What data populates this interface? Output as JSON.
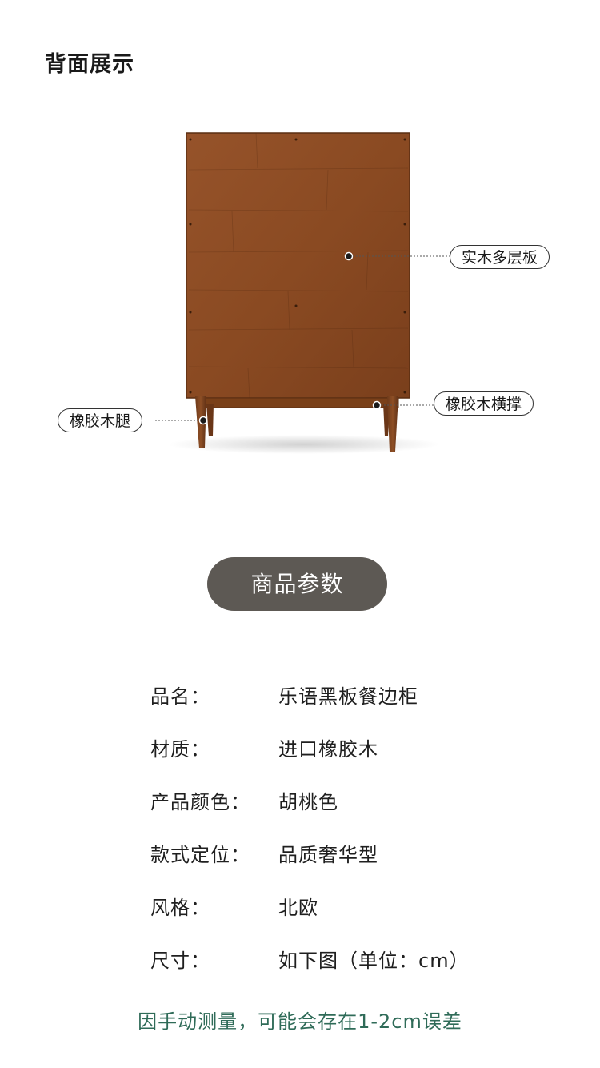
{
  "header": {
    "title": "背面展示"
  },
  "figure": {
    "callouts": {
      "plywood": "实木多层板",
      "brace": "橡胶木横撑",
      "leg": "橡胶木腿"
    }
  },
  "params": {
    "heading": "商品参数",
    "rows": [
      {
        "label": "品名：",
        "value": "乐语黑板餐边柜"
      },
      {
        "label": "材质：",
        "value": "进口橡胶木"
      },
      {
        "label": "产品颜色：",
        "value": "胡桃色"
      },
      {
        "label": "款式定位：",
        "value": "品质奢华型"
      },
      {
        "label": "风格：",
        "value": "北欧"
      },
      {
        "label": "尺寸：",
        "value": "如下图（单位：cm）"
      }
    ]
  },
  "footer": {
    "note": "因手动测量，可能会存在1-2cm误差"
  },
  "colors": {
    "wood": "#8a4a22",
    "pill": "#5d5954",
    "note": "#2f6b58"
  }
}
